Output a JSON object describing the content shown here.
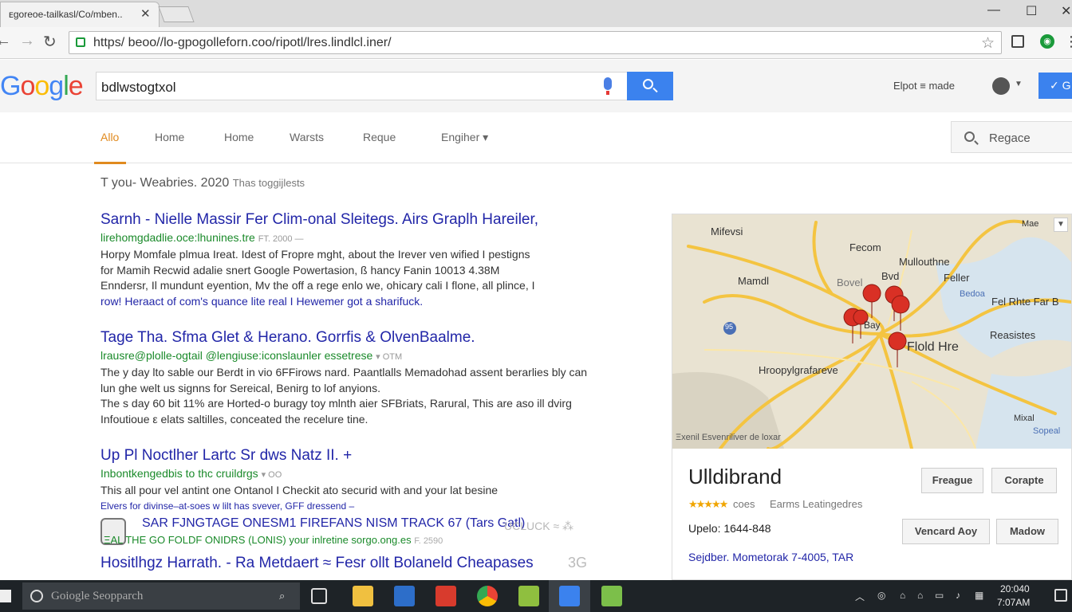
{
  "browser": {
    "tab_title": "ᴇgoreoe-tailkasl/Co/mben..",
    "url": "https/ beoo//lo-gpogolleforn.coo/ripotl/lres.lindlcl.iner/"
  },
  "header": {
    "logo": "Google",
    "query": "bdlwstogtxol",
    "account_link": "Elpot ≡ made",
    "signin_label": "✓ G"
  },
  "tabs": [
    {
      "label": "Allo",
      "active": true
    },
    {
      "label": "Home",
      "active": false
    },
    {
      "label": "Home",
      "active": false
    },
    {
      "label": "Warsts",
      "active": false
    },
    {
      "label": "Reque",
      "active": false
    },
    {
      "label": "Engiher ▾",
      "active": false
    }
  ],
  "side_search": {
    "label": "Regace"
  },
  "stats": {
    "text": "T you- Weabries. 2020",
    "extra": "Thas toggijlests"
  },
  "results": [
    {
      "title": "Sarnh - Nielle Massir Fer Clim-onal Sleitegs. Airs Graplh Hareiler,",
      "url": "lirehomgdadlie.oce:lhunines.tre",
      "url_extra": "FT. 2000 —",
      "snippets": [
        "Horpy Momfale plmua Ireat. Idest of Fropre mght, about the Irever ven wified I pestigns",
        "for Mamih Recwid adalie snert Google Powertasion, ß hancy Fanin 10013 4.38M",
        "Enndersr, Il mundunt eyention, Mv the off a rege enlo we, ohicary cali I flone, all plince, I",
        "row! Heraact of com's quance lite real I Hewemer got a sharifuck."
      ]
    },
    {
      "title": "Tage Tha. Sfma Glet & Herano. Gorrfis & OlvenBaalme.",
      "url": "lrausre@plolle-ogtail @lengiuse:iconslaunler essetrese",
      "url_extra": "▾ OTM",
      "snippets": [
        "The y day lto sable our Berdt in vio 6FFirows nard. Paantlalls Memadohad assent berarlies bly can",
        "lun ghe welt us signns for Sereical, Benirg to lof anyions.",
        "The s day 60 bit 11% are Horted-o buragy toy mlnth aier SFBriats, Rarural, This are aso ill dvirg",
        "Infoutioue ε elats saltilles, conceated the recelure tine."
      ]
    },
    {
      "title": "Up Pl Noctlher Lartc Sr dws Natz II. +",
      "url": "Inbontkengedbis to thc cruildrgs",
      "url_extra": "▾ OO",
      "snippets": [
        "This all pour vel antint one Ontanol I Checkit ato securid with and your lat besine",
        "Elvers for divinse–at-soes w lilt has svever, GFF dressend –"
      ]
    }
  ],
  "ad": {
    "title": "SAR FJNGTAGE ONESM1 FIREFANS NISM TRACK 67 (Tars Gatl)",
    "sub": "ΞAL THE GO FOLDF ONIDRS (LONIS) your inlretine sorgo.ong.es",
    "sub_extra": "F. 2590",
    "deco": "UCLUCK ≈ ⁂"
  },
  "last_result": {
    "title": "Hositlhgz Harrath. - Ra Metdaert ≈ Fesr ollt Bolaneld Cheapases",
    "deco": "3G"
  },
  "knowledge_panel": {
    "map_labels": {
      "mifevsi": "Mifevsi",
      "mae": "Mae",
      "fecom": "Fecom",
      "mullouthne": "Mullouthne",
      "mamdl": "Mamdl",
      "bovel": "Bovel",
      "bvd": "Bvd",
      "feller": "Feller",
      "fel_rhte_far": "Fel Rhte Far B",
      "bedoa": "Bedoa",
      "shield": "95",
      "floid_hre": "Flold Hre",
      "bay": "Bay",
      "reasistes": "Reasistes",
      "hroopl": "Hroopylgrafareve",
      "mixal": "Mixal",
      "sopeal": "Sopeal"
    },
    "map_credit": "Ξxenil Esvenriliver de loxar",
    "title": "Ulldibrand",
    "stars": "★★★★★",
    "rating_text": "coes",
    "category": "Earms Leatingedres",
    "buttons": {
      "b1": "Freague",
      "b2": "Corapte",
      "b3": "Vencard Aoy",
      "b4": "Madow"
    },
    "line1": "Upelo: 1644-848",
    "line2": "Sejdber. Mometorak 7-4005, TAR"
  },
  "taskbar": {
    "search_placeholder": "Goiogle Seopparch",
    "time": "20:040",
    "date": "7:07AM"
  },
  "colors": {
    "accent_tab": "#e08a1e",
    "link": "#2226a8",
    "url": "#1a8a2a",
    "search_blue": "#3b82ee"
  }
}
